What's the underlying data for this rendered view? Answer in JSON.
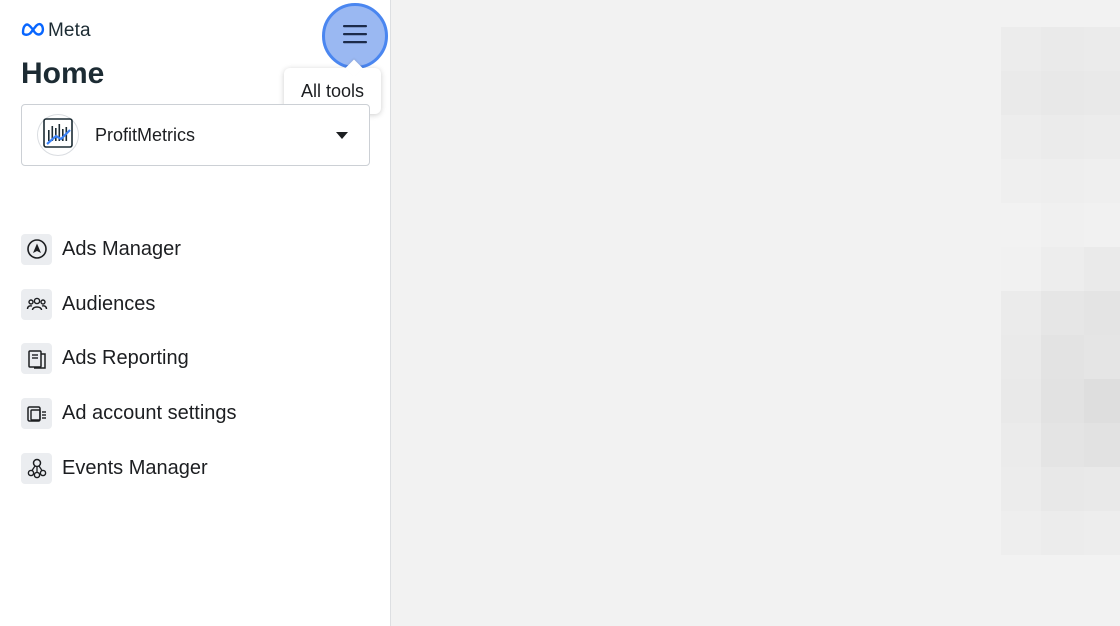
{
  "brand": {
    "name": "Meta",
    "logo_icon": "meta-infinity-logo",
    "accent_color": "#0866ff"
  },
  "page": {
    "title": "Home"
  },
  "header": {
    "menu_icon": "hamburger-menu-icon",
    "tooltip": "All tools"
  },
  "account": {
    "name": "ProfitMetrics",
    "avatar_icon": "profitmetrics-chart-logo"
  },
  "nav": {
    "items": [
      {
        "label": "Ads Manager",
        "icon": "navigation-arrow-icon"
      },
      {
        "label": "Audiences",
        "icon": "people-group-icon"
      },
      {
        "label": "Ads Reporting",
        "icon": "report-pages-icon"
      },
      {
        "label": "Ad account settings",
        "icon": "account-settings-icon"
      },
      {
        "label": "Events Manager",
        "icon": "events-nodes-icon"
      }
    ]
  }
}
